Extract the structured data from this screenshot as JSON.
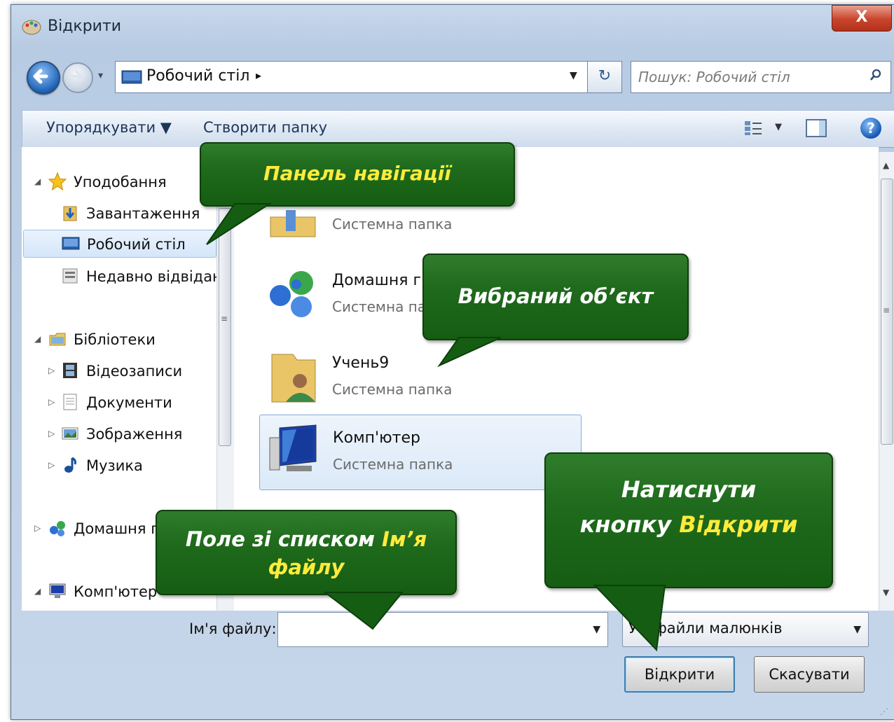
{
  "window": {
    "title": "Відкрити",
    "close_label": "X"
  },
  "nav": {
    "back_icon": "back-arrow-icon",
    "forward_icon": "forward-arrow-icon",
    "history_drop": "▾",
    "address_path": "Робочий стіл",
    "address_sep": "▸",
    "address_drop": "▼",
    "refresh_label": "↻",
    "search_placeholder": "Пошук: Робочий стіл"
  },
  "toolbar": {
    "organize_label": "Упорядкувати ▼",
    "new_folder_label": "Створити папку",
    "views_drop": "▼",
    "help_label": "?"
  },
  "sidebar": {
    "items": [
      {
        "label": "Уподобання",
        "icon": "star-icon"
      },
      {
        "label": "Завантаження",
        "icon": "downloads-icon"
      },
      {
        "label": "Робочий стіл",
        "icon": "desktop-icon",
        "selected": true
      },
      {
        "label": "Недавно відвідан",
        "icon": "recent-places-icon"
      },
      {
        "label": "Бібліотеки",
        "icon": "libraries-icon"
      },
      {
        "label": "Відеозаписи",
        "icon": "videos-icon"
      },
      {
        "label": "Документи",
        "icon": "documents-icon"
      },
      {
        "label": "Зображення",
        "icon": "pictures-icon"
      },
      {
        "label": "Музика",
        "icon": "music-icon"
      },
      {
        "label": "Домашня г",
        "icon": "homegroup-icon"
      },
      {
        "label": "Комп'ютер",
        "icon": "computer-icon"
      }
    ],
    "scroll_grip": "≡"
  },
  "files": {
    "items": [
      {
        "name": "",
        "type": "Системна папка",
        "icon": "folder-icon"
      },
      {
        "name": "Домашня гру",
        "type": "Системна папк",
        "icon": "homegroup-icon"
      },
      {
        "name": "Учень9",
        "type": "Системна папка",
        "icon": "user-folder-icon"
      },
      {
        "name": "Комп'ютер",
        "type": "Системна папка",
        "icon": "computer-icon",
        "selected": true
      },
      {
        "name": "",
        "type": "",
        "icon": "network-icon"
      }
    ],
    "scroll_grip": "≡",
    "scroll_up": "▲",
    "scroll_down": "▼"
  },
  "footer": {
    "filename_label": "Ім'я файлу:",
    "filename_value": "",
    "filename_drop": "▼",
    "filter_value": "Усі файли малюнків",
    "filter_drop": "▼",
    "open_label": "Відкрити",
    "cancel_label": "Скасувати",
    "grip": "⋰"
  },
  "callouts": {
    "nav_pane": "Панель навігації",
    "selected_obj": "Вибраний об’єкт",
    "open_line1": "Натиснути",
    "open_line2_prefix": "кнопку ",
    "open_line2_highlight": "Відкрити",
    "filename_prefix": "Поле зі списком ",
    "filename_highlight1": "Ім’я",
    "filename_highlight2": "файлу"
  },
  "colors": {
    "callout_green": "#1f6a1c",
    "highlight_yellow": "#ffeb3b",
    "selection_blue": "#dbe9f8"
  }
}
